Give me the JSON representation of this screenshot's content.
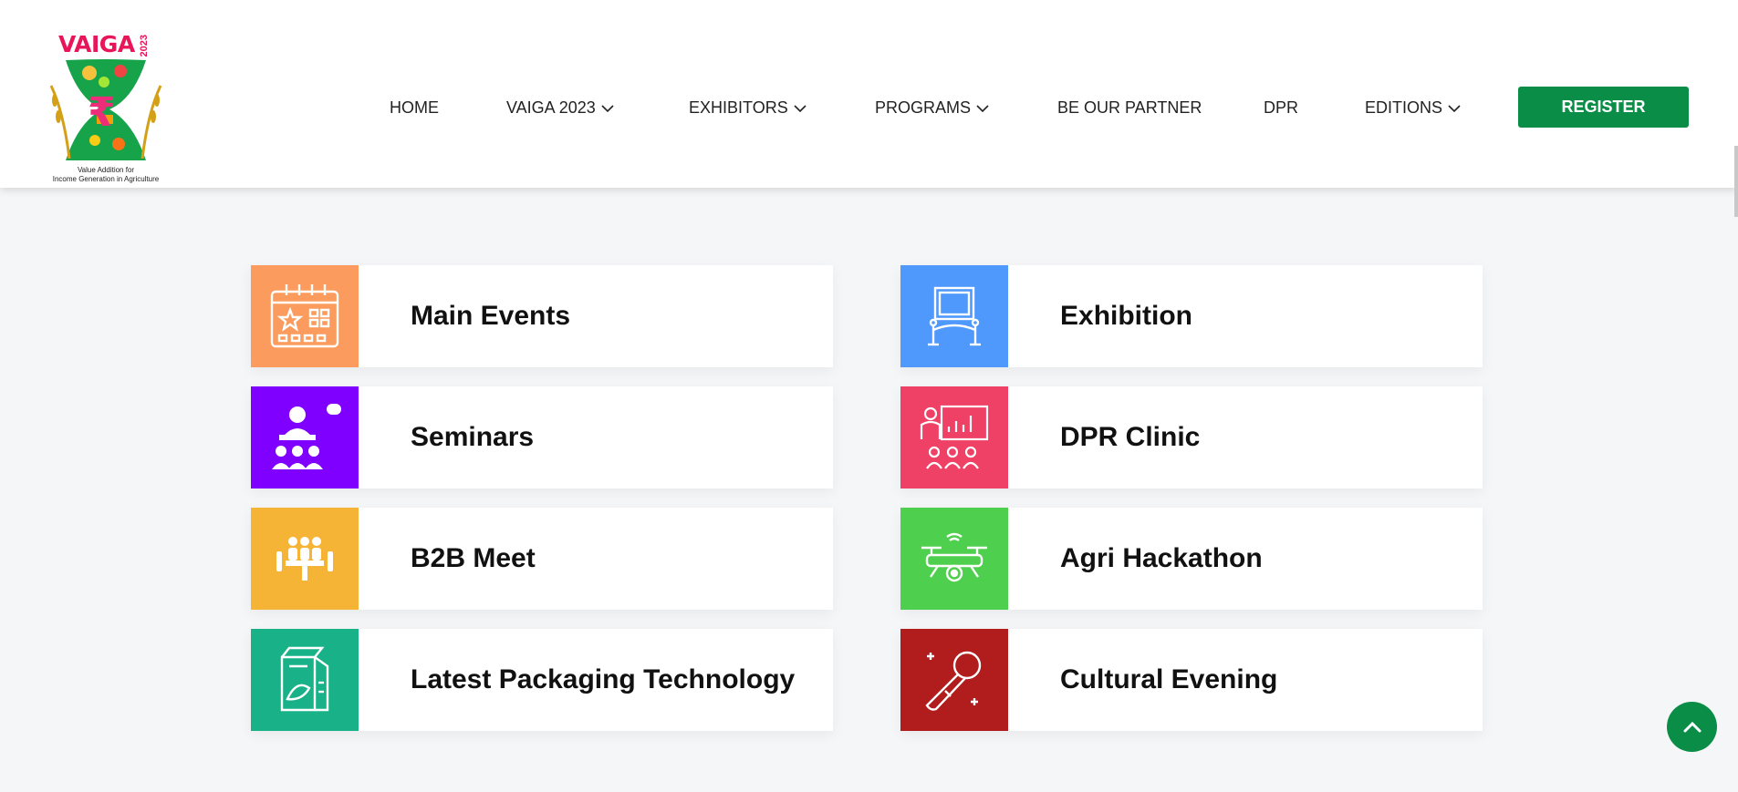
{
  "logo": {
    "title": "VAIGA",
    "year": "2023",
    "caption_line1": "Value Addition for",
    "caption_line2": "Income Generation in Agriculture"
  },
  "nav": {
    "items": [
      {
        "label": "HOME",
        "dropdown": false
      },
      {
        "label": "VAIGA 2023",
        "dropdown": true
      },
      {
        "label": "EXHIBITORS",
        "dropdown": true
      },
      {
        "label": "PROGRAMS",
        "dropdown": true
      },
      {
        "label": "BE OUR PARTNER",
        "dropdown": false
      },
      {
        "label": "DPR",
        "dropdown": false
      },
      {
        "label": "EDITIONS",
        "dropdown": true
      }
    ],
    "register_label": "REGISTER"
  },
  "programs": [
    {
      "label": "Main Events",
      "color": "#fb9c5e",
      "icon": "calendar-star-icon"
    },
    {
      "label": "Exhibition",
      "color": "#4f98fc",
      "icon": "exhibition-frame-icon"
    },
    {
      "label": "Seminars",
      "color": "#7f00ff",
      "icon": "seminar-speaker-icon"
    },
    {
      "label": "DPR Clinic",
      "color": "#ef4166",
      "icon": "presentation-board-icon"
    },
    {
      "label": "B2B Meet",
      "color": "#f6b436",
      "icon": "meeting-table-icon"
    },
    {
      "label": "Agri Hackathon",
      "color": "#4fcf4e",
      "icon": "drone-icon"
    },
    {
      "label": "Latest Packaging Technology",
      "color": "#19b288",
      "icon": "package-box-icon"
    },
    {
      "label": "Cultural Evening",
      "color": "#b11c1c",
      "icon": "microphone-icon"
    }
  ],
  "colors": {
    "accent": "#0a8d46",
    "brand": "#e8155b",
    "page_bg": "#f5f6f8"
  }
}
